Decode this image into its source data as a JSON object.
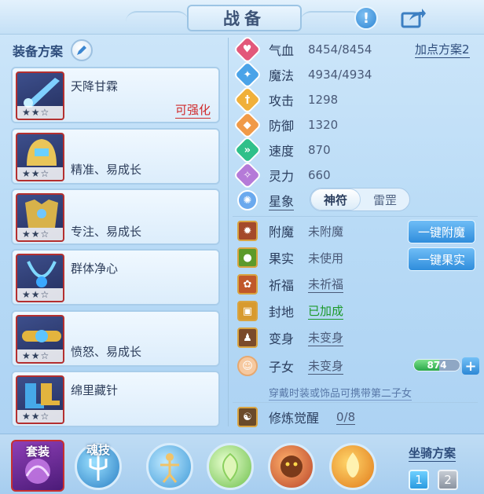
{
  "title": "战备",
  "left": {
    "header": "装备方案",
    "cards": [
      {
        "name": "天降甘霖",
        "stars": "★★☆",
        "tag": "可强化"
      },
      {
        "name": "精准、易成长",
        "stars": "★★☆",
        "tag": ""
      },
      {
        "name": "专注、易成长",
        "stars": "★★☆",
        "tag": ""
      },
      {
        "name": "群体净心",
        "stars": "★★☆",
        "tag": ""
      },
      {
        "name": "愤怒、易成长",
        "stars": "★★☆",
        "tag": ""
      },
      {
        "name": "绵里藏针",
        "stars": "★★☆",
        "tag": ""
      }
    ]
  },
  "stats": {
    "hp_label": "气血",
    "hp": "8454/8454",
    "mp_label": "魔法",
    "mp": "4934/4934",
    "atk_label": "攻击",
    "atk": "1298",
    "def_label": "防御",
    "def": "1320",
    "spd_label": "速度",
    "spd": "870",
    "spirit_label": "灵力",
    "spirit": "660",
    "plan_link": "加点方案2"
  },
  "star": {
    "label": "星象",
    "opt_on": "神符",
    "opt_off": "雷罡"
  },
  "attrs": {
    "enchant_label": "附魔",
    "enchant": "未附魔",
    "enchant_btn": "一键附魔",
    "fruit_label": "果实",
    "fruit": "未使用",
    "fruit_btn": "一键果实",
    "bless_label": "祈福",
    "bless": "未祈福",
    "fief_label": "封地",
    "fief": "已加成",
    "transform_label": "变身",
    "transform": "未变身",
    "child_label": "子女",
    "child": "未变身",
    "child_value": "874",
    "child_progress": 0.55,
    "hint": "穿戴时装或饰品可携带第二子女",
    "awaken_label": "修炼觉醒",
    "awaken": "0/8"
  },
  "bottom": {
    "set_label": "套装",
    "skill_label": "魂技",
    "mount_label": "坐骑方案",
    "mount_1": "1",
    "mount_2": "2"
  },
  "colors": {
    "red_tag": "#d02a2a",
    "green_ok": "#1c9a2a",
    "accent_blue": "#2f8ddc"
  }
}
